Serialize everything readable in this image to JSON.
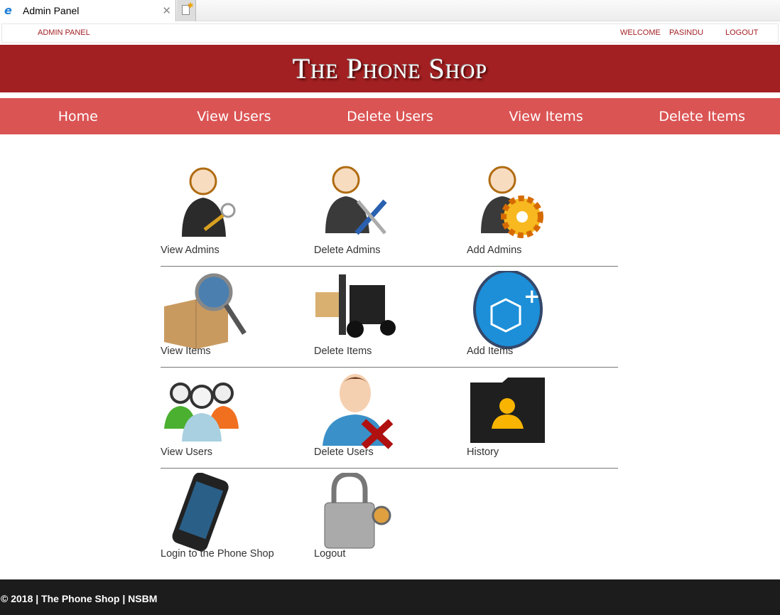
{
  "browser": {
    "tab_title": "Admin Panel"
  },
  "topbar": {
    "left": "ADMIN PANEL",
    "welcome": "WELCOME",
    "user": "PASINDU",
    "logout": "LOGOUT"
  },
  "banner": {
    "logo_text": "The Phone Shop"
  },
  "nav": [
    "Home",
    "View Users",
    "Delete Users",
    "View Items",
    "Delete Items"
  ],
  "tiles": [
    [
      {
        "label": "View Admins",
        "icon": "admin-keys-icon"
      },
      {
        "label": "Delete Admins",
        "icon": "admin-tools-icon"
      },
      {
        "label": "Add Admins",
        "icon": "admin-gear-icon"
      }
    ],
    [
      {
        "label": "View Items",
        "icon": "box-magnifier-icon"
      },
      {
        "label": "Delete Items",
        "icon": "forklift-icon"
      },
      {
        "label": "Add Items",
        "icon": "add-boxes-icon"
      }
    ],
    [
      {
        "label": "View Users",
        "icon": "users-group-icon"
      },
      {
        "label": "Delete Users",
        "icon": "user-delete-icon"
      },
      {
        "label": "History",
        "icon": "folder-user-icon"
      }
    ],
    [
      {
        "label": "Login to the Phone Shop",
        "icon": "phone-icon"
      },
      {
        "label": "Logout",
        "icon": "padlock-icon"
      }
    ]
  ],
  "footer": {
    "text": "© 2018 | The Phone Shop | NSBM"
  }
}
